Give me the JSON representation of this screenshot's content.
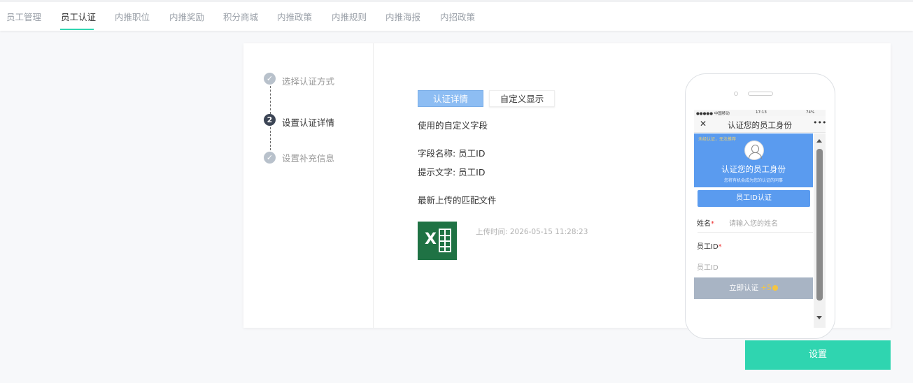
{
  "nav": {
    "tabs": [
      {
        "label": "员工管理",
        "active": false
      },
      {
        "label": "员工认证",
        "active": true
      },
      {
        "label": "内推职位",
        "active": false
      },
      {
        "label": "内推奖励",
        "active": false
      },
      {
        "label": "积分商城",
        "active": false
      },
      {
        "label": "内推政策",
        "active": false
      },
      {
        "label": "内推规则",
        "active": false
      },
      {
        "label": "内推海报",
        "active": false
      },
      {
        "label": "内招政策",
        "active": false
      }
    ],
    "active_underline_color": "#2fd5b0"
  },
  "steps": [
    {
      "number": "",
      "label": "选择认证方式",
      "state": "done"
    },
    {
      "number": "2",
      "label": "设置认证详情",
      "state": "current"
    },
    {
      "number": "",
      "label": "设置补充信息",
      "state": "done"
    }
  ],
  "detail": {
    "tab_primary": "认证详情",
    "tab_secondary": "自定义显示",
    "section_title": "使用的自定义字段",
    "field_name": "字段名称: 员工ID",
    "hint_text": "提示文字: 员工ID",
    "upload_title": "最新上传的匹配文件",
    "upload_time": "上传时间: 2026-05-15 11:28:23",
    "file_icon": "excel-file-icon"
  },
  "preview": {
    "status_carrier": "●●●●● 中国移动",
    "status_time": "17:13",
    "status_battery": "74%",
    "header_title": "认证您的员工身份",
    "close_glyph": "✕",
    "more_glyph": "•••",
    "banner_hint": "未经认证，无法推荐",
    "banner_title": "认证您的员工身份",
    "banner_subtitle": "您将有机会成为您的认证的同事",
    "id_button": "员工ID认证",
    "name_label": "姓名",
    "name_placeholder": "请输入您的姓名",
    "id_label": "员工ID",
    "id_placeholder": "员工ID",
    "required_mark": "*",
    "submit_label": "立即认证",
    "submit_bonus": "+5",
    "accent_color": "#5a9bef"
  },
  "footer": {
    "save_label": "设置",
    "save_color": "#2fd5b0"
  }
}
